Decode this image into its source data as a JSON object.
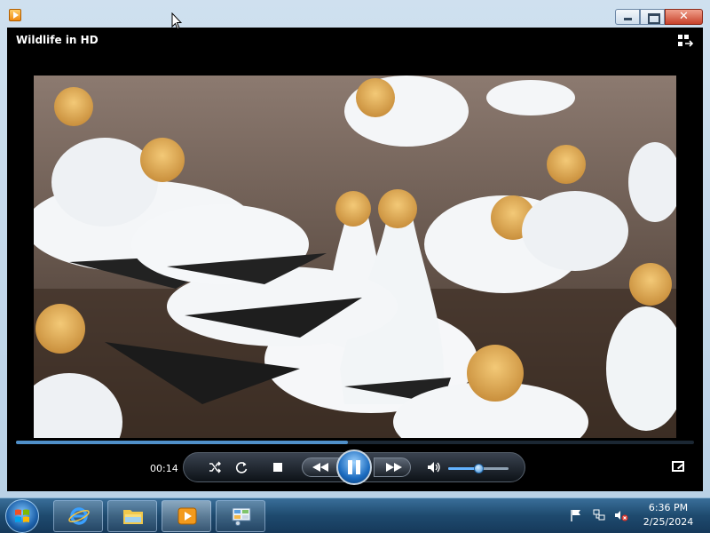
{
  "window": {
    "title": "Wildlife in HD",
    "close_glyph": "✕"
  },
  "player": {
    "elapsed": "00:14",
    "progress": 0.49,
    "volume": 0.5,
    "state": "playing"
  },
  "icons": {
    "app": "media-player-icon",
    "switch_view": "switch-to-library-icon",
    "shuffle": "shuffle-icon",
    "repeat": "repeat-icon",
    "stop": "stop-icon",
    "previous": "previous-icon",
    "pause": "pause-icon",
    "next": "next-icon",
    "mute": "speaker-icon",
    "fullscreen": "fullscreen-icon"
  },
  "taskbar": {
    "items": [
      "start-button",
      "internet-explorer",
      "windows-explorer",
      "windows-media-player",
      "control-panel"
    ],
    "clock_time": "6:36 PM",
    "clock_date": "2/25/2024"
  },
  "colors": {
    "accent": "#4f8fc9",
    "player_bg": "#000000",
    "window_frame": "#c3d8eb",
    "taskbar": "#1e4a6e"
  }
}
